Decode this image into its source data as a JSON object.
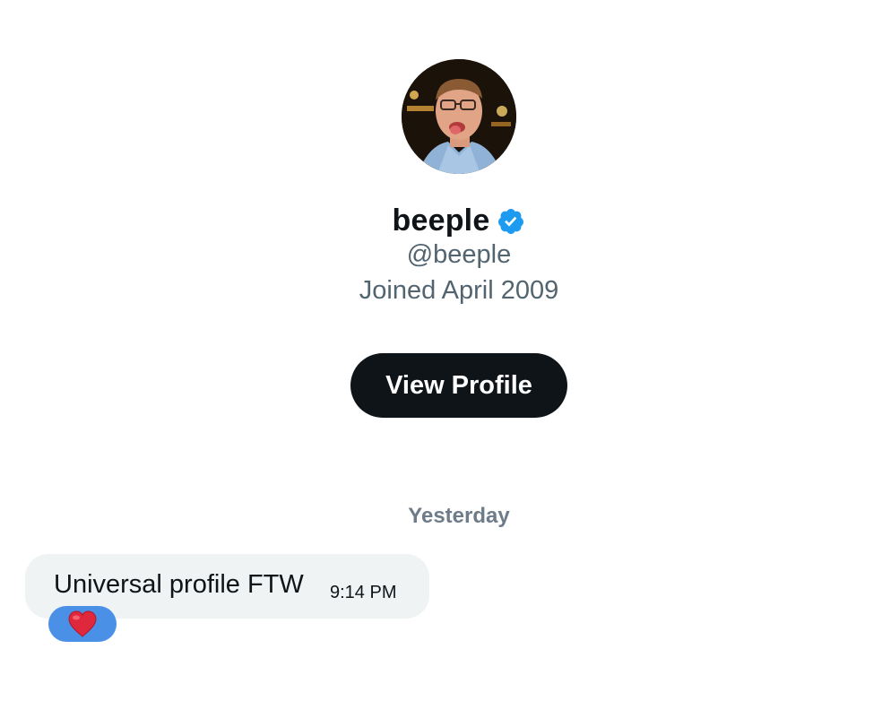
{
  "profile": {
    "display_name": "beeple",
    "handle": "@beeple",
    "joined": "Joined April 2009",
    "verified": true,
    "avatar_icon": "user-photo-avatar",
    "verified_icon": "verified-badge-icon"
  },
  "actions": {
    "view_profile_label": "View Profile"
  },
  "conversation": {
    "date_separator": "Yesterday",
    "messages": [
      {
        "text": "Universal profile FTW",
        "time": "9:14 PM",
        "reaction": "❤️",
        "reaction_icon": "heart-icon"
      }
    ]
  },
  "colors": {
    "accent": "#1d9bf0",
    "button_bg": "#0f1419",
    "secondary_text": "#536471",
    "bubble_bg": "#eff3f4",
    "reaction_bg": "#4a90e6"
  }
}
